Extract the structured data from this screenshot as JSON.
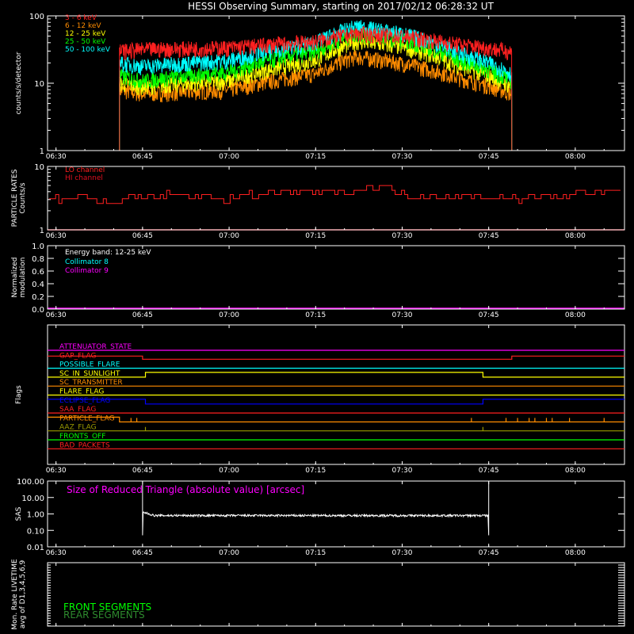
{
  "title": "HESSI Observing Summary, starting on 2017/02/12 06:28:32 UT",
  "time_ticks": [
    "06:30",
    "06:45",
    "07:00",
    "07:15",
    "07:30",
    "07:45",
    "08:00"
  ],
  "colors": {
    "bg": "#000000",
    "axis": "#ffffff",
    "red": "#ff2020",
    "orange": "#ff8c00",
    "yellow": "#ffff00",
    "green": "#00ff00",
    "cyan": "#00ffff",
    "magenta": "#ff00ff",
    "blue": "#0000ff",
    "darkred": "#e01020",
    "olive": "#9a9a00"
  },
  "chart_data": [
    {
      "id": "counts",
      "type": "line",
      "ylabel": "counts/s/detector",
      "ylog": true,
      "ylim": [
        1,
        100
      ],
      "yticks": [
        "1",
        "10",
        "100"
      ],
      "x_range": [
        "06:28:32",
        "08:08:32"
      ],
      "observation_window": [
        "06:41",
        "07:49"
      ],
      "series": [
        {
          "name": "3 - 6  keV",
          "color": "#ff2020",
          "x": [
            "06:41",
            "06:45",
            "07:00",
            "07:15",
            "07:22",
            "07:30",
            "07:40",
            "07:49"
          ],
          "y": [
            30,
            32,
            34,
            42,
            55,
            50,
            38,
            30
          ]
        },
        {
          "name": "6 - 12  keV",
          "color": "#ff8c00",
          "x": [
            "06:41",
            "06:45",
            "07:00",
            "07:15",
            "07:22",
            "07:30",
            "07:40",
            "07:49"
          ],
          "y": [
            8,
            7,
            8,
            14,
            25,
            20,
            12,
            7
          ]
        },
        {
          "name": "12 - 25  keV",
          "color": "#ffff00",
          "x": [
            "06:41",
            "06:45",
            "07:00",
            "07:15",
            "07:22",
            "07:30",
            "07:40",
            "07:49"
          ],
          "y": [
            10,
            9,
            11,
            22,
            42,
            35,
            18,
            9
          ]
        },
        {
          "name": "25 - 50  keV",
          "color": "#00ff00",
          "x": [
            "06:41",
            "06:45",
            "07:00",
            "07:15",
            "07:22",
            "07:30",
            "07:40",
            "07:49"
          ],
          "y": [
            13,
            11,
            15,
            30,
            55,
            45,
            22,
            11
          ]
        },
        {
          "name": "50 - 100  keV",
          "color": "#00ffff",
          "x": [
            "06:41",
            "06:45",
            "07:00",
            "07:15",
            "07:22",
            "07:30",
            "07:40",
            "07:49"
          ],
          "y": [
            20,
            18,
            22,
            40,
            70,
            55,
            28,
            14
          ]
        }
      ]
    },
    {
      "id": "particle",
      "type": "line",
      "ylabel": "PARTICLE RATES",
      "ylabel2": "Counts/s",
      "ylog": true,
      "ylim": [
        1,
        10
      ],
      "yticks": [
        "1",
        "10"
      ],
      "series": [
        {
          "name": "LO channel",
          "color": "#ff2020",
          "x": [
            "06:29",
            "06:34",
            "06:38",
            "06:42",
            "06:50",
            "07:00",
            "07:10",
            "07:20",
            "07:25",
            "07:30",
            "07:40",
            "07:50",
            "08:05"
          ],
          "y": [
            3,
            3.5,
            2.6,
            3,
            3.5,
            3.2,
            4,
            4,
            5,
            3.5,
            3.5,
            3.1,
            4
          ]
        },
        {
          "name": "HI channel",
          "color": "#e01020",
          "x": [
            "06:28",
            "08:08"
          ],
          "y": [
            1,
            1
          ]
        }
      ]
    },
    {
      "id": "modulation",
      "type": "line",
      "ylabel": "Normalized",
      "ylabel2": "modulation",
      "ylim": [
        0,
        1
      ],
      "yticks": [
        "0.0",
        "0.2",
        "0.4",
        "0.6",
        "0.8",
        "1.0"
      ],
      "annotation": "Energy band: 12-25 keV",
      "series": [
        {
          "name": "Collimator 8",
          "color": "#00ffff",
          "x": [],
          "y": []
        },
        {
          "name": "Collimator 9",
          "color": "#ff00ff",
          "x": [
            "06:28",
            "08:08"
          ],
          "y": [
            0,
            0
          ]
        }
      ]
    },
    {
      "id": "flags",
      "type": "line",
      "ylabel": "Flags",
      "series": [
        {
          "name": "ATTENUATOR_STATE",
          "color": "#ff00ff"
        },
        {
          "name": "GAP_FLAG",
          "color": "#ff2020"
        },
        {
          "name": "POSSIBLE_FLARE",
          "color": "#00ffff"
        },
        {
          "name": "SC_IN_SUNLIGHT",
          "color": "#ffff00"
        },
        {
          "name": "SC_TRANSMITTER",
          "color": "#ff8c00"
        },
        {
          "name": "FLARE_FLAG",
          "color": "#ffff00"
        },
        {
          "name": "ECLIPSE_FLAG",
          "color": "#0000ff"
        },
        {
          "name": "SAA_FLAG",
          "color": "#ff2020"
        },
        {
          "name": "PARTICLE_FLAG",
          "color": "#ff8c00"
        },
        {
          "name": "AAZ_FLAG",
          "color": "#9a9a00"
        },
        {
          "name": "FRONTS_OFF",
          "color": "#00ff00"
        },
        {
          "name": "BAD_PACKETS",
          "color": "#ff2020"
        }
      ]
    },
    {
      "id": "sas",
      "type": "line",
      "ylabel": "SAS",
      "ylog": true,
      "ylim": [
        0.01,
        100
      ],
      "yticks": [
        "0.01",
        "0.10",
        "1.00",
        "10.00",
        "100.00"
      ],
      "annotation": "Size of Reduced Triangle (absolute value) [arcsec]",
      "series": [
        {
          "name": "",
          "color": "#ffffff",
          "x": [
            "06:45",
            "06:46",
            "07:00",
            "07:15",
            "07:30",
            "07:44",
            "07:45"
          ],
          "y": [
            100,
            0.8,
            0.8,
            0.8,
            0.8,
            0.8,
            100
          ]
        }
      ]
    },
    {
      "id": "livetime",
      "type": "line",
      "ylabel": "Mon. Rate LIVETIME",
      "ylabel2": "avg of D1,3,4,5,6,9",
      "series": [
        {
          "name": "FRONT SEGMENTS",
          "color": "#00ff00",
          "x": [],
          "y": []
        },
        {
          "name": "REAR SEGMENTS",
          "color": "#2e8b2e",
          "x": [],
          "y": []
        }
      ]
    }
  ]
}
